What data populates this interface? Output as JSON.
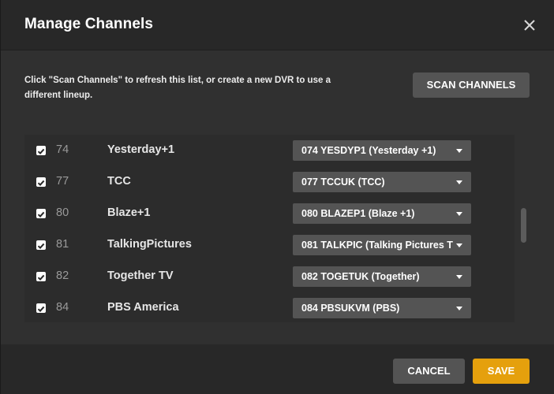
{
  "dialog": {
    "title": "Manage Channels",
    "description": "Click \"Scan Channels\" to refresh this list, or create a new DVR to use a different lineup.",
    "scan_label": "SCAN CHANNELS"
  },
  "channels": [
    {
      "checked": true,
      "number": "74",
      "name": "Yesterday+1",
      "lineup": "074 YESDYP1 (Yesterday +1)"
    },
    {
      "checked": true,
      "number": "77",
      "name": "TCC",
      "lineup": "077 TCCUK (TCC)"
    },
    {
      "checked": true,
      "number": "80",
      "name": "Blaze+1",
      "lineup": "080 BLAZEP1 (Blaze +1)"
    },
    {
      "checked": true,
      "number": "81",
      "name": "TalkingPictures",
      "lineup": "081 TALKPIC (Talking Pictures T"
    },
    {
      "checked": true,
      "number": "82",
      "name": "Together TV",
      "lineup": "082 TOGETUK (Together)"
    },
    {
      "checked": true,
      "number": "84",
      "name": "PBS America",
      "lineup": "084 PBSUKVM (PBS)"
    }
  ],
  "footer": {
    "cancel_label": "CANCEL",
    "save_label": "SAVE"
  },
  "colors": {
    "accent": "#e5a00d",
    "button": "#545454",
    "background": "#282828"
  },
  "icons": {
    "close": "close-icon",
    "checkbox": "checkbox-checked-icon",
    "dropdown": "chevron-down-icon"
  }
}
